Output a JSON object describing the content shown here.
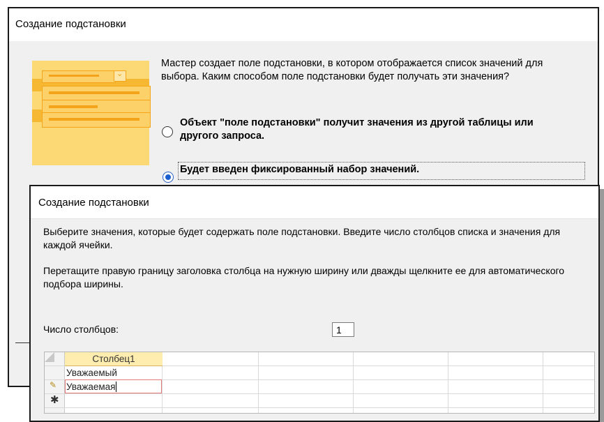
{
  "wizard1": {
    "title": "Создание подстановки",
    "description": "Мастер создает поле подстановки, в котором отображается список значений для выбора.  Каким способом поле подстановки будет получать эти значения?",
    "option_table": "Объект \"поле подстановки\" получит значения из другой таблицы или другого запроса.",
    "option_fixed": "Будет введен фиксированный набор значений.",
    "selected_option": "option_fixed"
  },
  "wizard2": {
    "title": "Создание подстановки",
    "instruction1": "Выберите значения, которые будет содержать поле подстановки. Введите число столбцов списка и значения для каждой ячейки.",
    "instruction2": "Перетащите правую границу заголовка столбца на нужную ширину или дважды щелкните ее для автоматического подбора ширины.",
    "columns_label": "Число столбцов:",
    "columns_value": "1",
    "grid": {
      "header": "Столбец1",
      "rows": [
        "Уважаемый",
        "Уважаемая",
        ""
      ],
      "editing_row": 1
    }
  },
  "icons": {
    "pencil": "pencil-icon",
    "new_row": "asterisk-icon"
  },
  "colors": {
    "radio_selected": "#1c5fd0",
    "header_fill": "#ffedb0",
    "edit_border": "#e37b7b",
    "illustration": "#fcd975"
  }
}
